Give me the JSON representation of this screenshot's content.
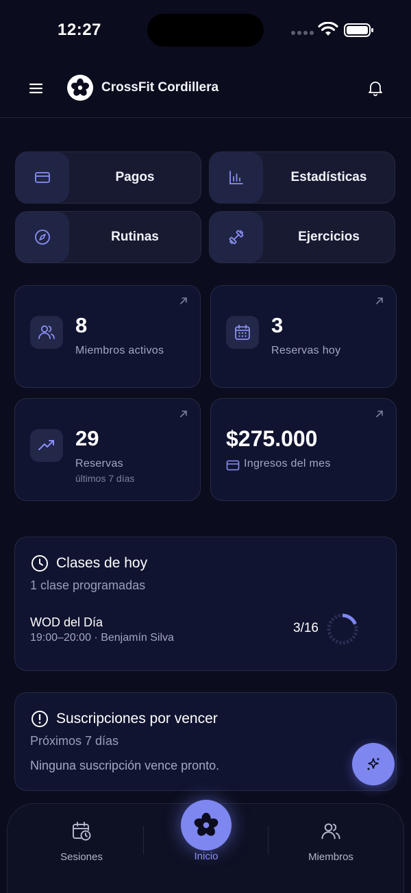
{
  "status_bar": {
    "time": "12:27"
  },
  "header": {
    "title": "CrossFit Cordillera"
  },
  "quick_actions": [
    {
      "label": "Pagos",
      "icon": "credit-card-icon"
    },
    {
      "label": "Estadísticas",
      "icon": "bar-chart-icon"
    },
    {
      "label": "Rutinas",
      "icon": "compass-icon"
    },
    {
      "label": "Ejercicios",
      "icon": "dumbbell-icon"
    }
  ],
  "stats": [
    {
      "value": "8",
      "label": "Miembros activos",
      "icon": "users-icon"
    },
    {
      "value": "3",
      "label": "Reservas hoy",
      "icon": "calendar-icon"
    },
    {
      "value": "29",
      "label": "Reservas",
      "sublabel": "últimos 7 días",
      "icon": "trending-up-icon"
    },
    {
      "value": "$275.000",
      "label": "Ingresos del mes",
      "icon": "credit-card-icon"
    }
  ],
  "today_classes": {
    "title": "Clases de hoy",
    "subtitle": "1 clase programadas",
    "classes": [
      {
        "name": "WOD del Día",
        "meta": "19:00–20:00 · Benjamín Silva",
        "count": "3/16",
        "booked": 3,
        "capacity": 16
      }
    ]
  },
  "expiring": {
    "title": "Suscripciones por vencer",
    "subtitle": "Próximos 7 días",
    "empty_text": "Ninguna suscripción vence pronto."
  },
  "bottom_nav": {
    "sessions": "Sesiones",
    "home": "Inicio",
    "members": "Miembros"
  },
  "colors": {
    "accent": "#7e86f0",
    "background": "#0b0d1e",
    "card": "#111430",
    "icon_tint": "#8a8ff5"
  }
}
